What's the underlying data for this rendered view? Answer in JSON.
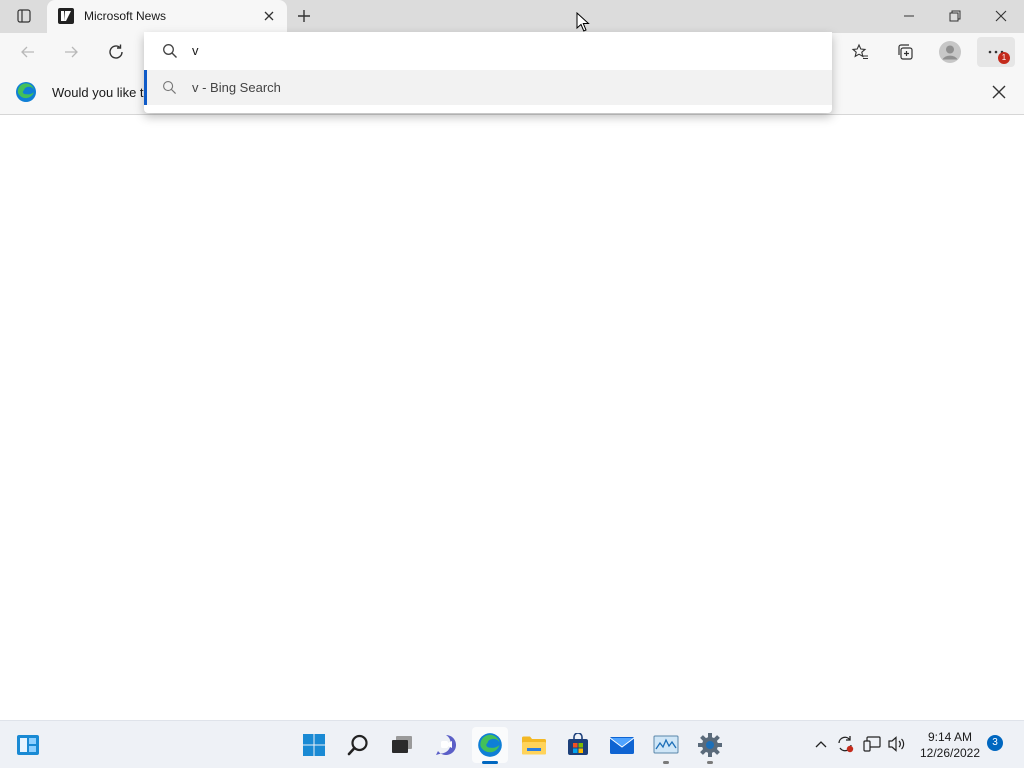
{
  "browser": {
    "tab": {
      "title": "Microsoft News"
    },
    "infobar": {
      "message": "Would you like t"
    },
    "omnibox": {
      "input_value": "v",
      "suggestions": [
        {
          "text": "v - Bing Search"
        }
      ]
    },
    "menu_badge": "1"
  },
  "taskbar": {
    "clock": {
      "time": "9:14 AM",
      "date": "12/26/2022"
    },
    "notification_count": "3"
  },
  "colors": {
    "accent": "#0f5bc8",
    "badge": "#c42b1c"
  }
}
